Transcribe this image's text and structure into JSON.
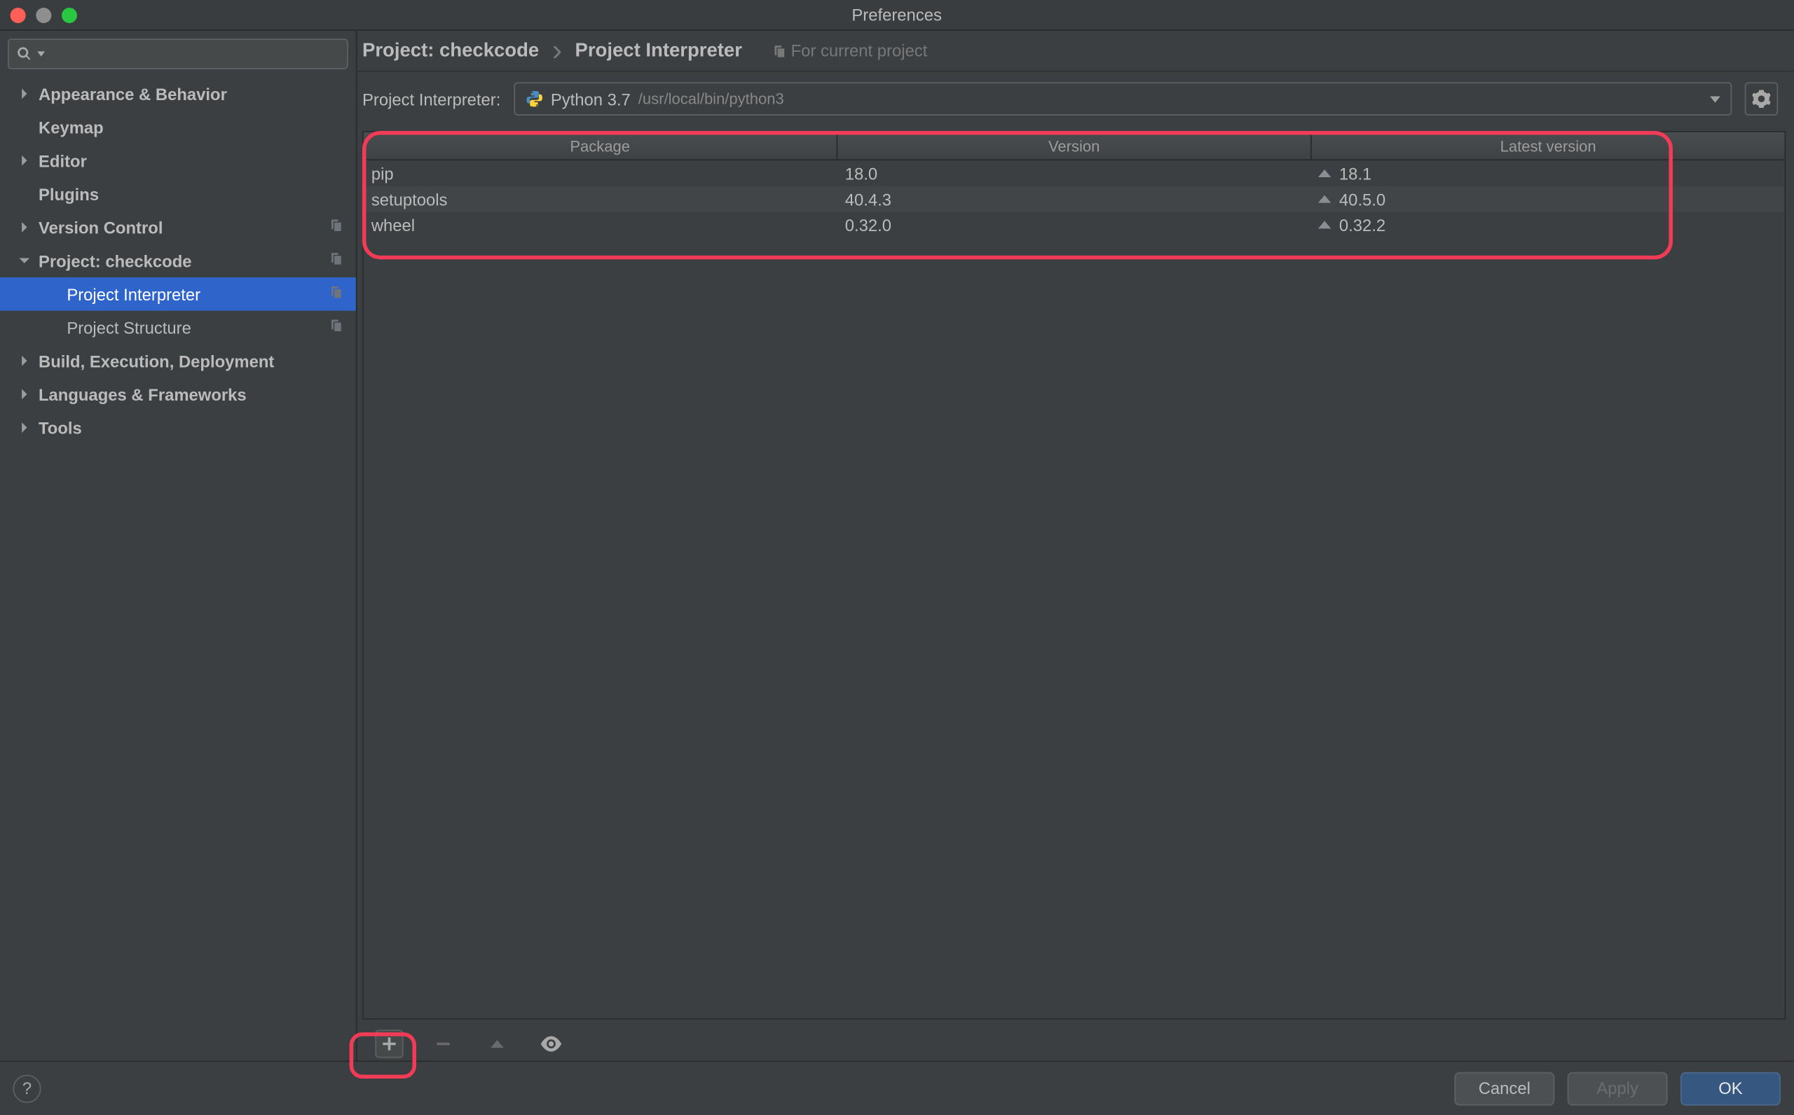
{
  "window": {
    "title": "Preferences"
  },
  "sidebar": {
    "search_placeholder": "",
    "items": [
      {
        "label": "Appearance & Behavior",
        "expandable": true,
        "bold": true
      },
      {
        "label": "Keymap",
        "expandable": false,
        "bold": true
      },
      {
        "label": "Editor",
        "expandable": true,
        "bold": true
      },
      {
        "label": "Plugins",
        "expandable": false,
        "bold": true
      },
      {
        "label": "Version Control",
        "expandable": true,
        "bold": true,
        "trail": true
      },
      {
        "label": "Project: checkcode",
        "expandable": true,
        "bold": true,
        "open": true,
        "trail": true
      },
      {
        "label": "Project Interpreter",
        "child": true,
        "selected": true,
        "trail": true
      },
      {
        "label": "Project Structure",
        "child": true,
        "trail": true
      },
      {
        "label": "Build, Execution, Deployment",
        "expandable": true,
        "bold": true
      },
      {
        "label": "Languages & Frameworks",
        "expandable": true,
        "bold": true
      },
      {
        "label": "Tools",
        "expandable": true,
        "bold": true
      }
    ]
  },
  "breadcrumb": {
    "project": "Project: checkcode",
    "page": "Project Interpreter",
    "hint": "For current project"
  },
  "interpreter": {
    "label": "Project Interpreter:",
    "name": "Python 3.7",
    "path": "/usr/local/bin/python3"
  },
  "packages": {
    "columns": {
      "package": "Package",
      "version": "Version",
      "latest": "Latest version"
    },
    "rows": [
      {
        "name": "pip",
        "version": "18.0",
        "latest": "18.1",
        "upgrade": true
      },
      {
        "name": "setuptools",
        "version": "40.4.3",
        "latest": "40.5.0",
        "upgrade": true
      },
      {
        "name": "wheel",
        "version": "0.32.0",
        "latest": "0.32.2",
        "upgrade": true
      }
    ]
  },
  "footer": {
    "cancel": "Cancel",
    "apply": "Apply",
    "ok": "OK"
  }
}
